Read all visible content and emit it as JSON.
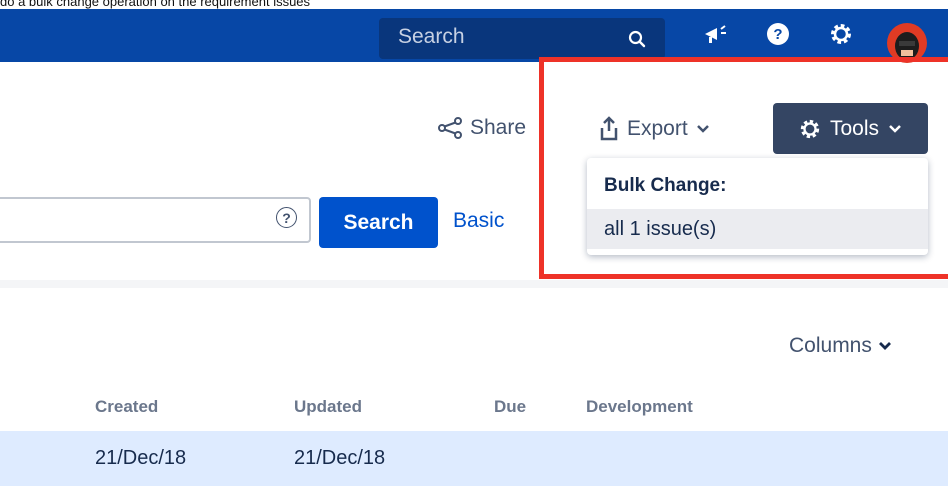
{
  "caption": "do a bulk change operation on the requirement issues",
  "topbar": {
    "search_placeholder": "Search",
    "icons": [
      "search-icon",
      "megaphone-icon",
      "help-icon",
      "gear-icon",
      "avatar"
    ]
  },
  "toolbar": {
    "share_label": "Share",
    "export_label": "Export",
    "tools_label": "Tools"
  },
  "tools_menu": {
    "header": "Bulk Change:",
    "items": [
      {
        "label": "all 1 issue(s)"
      }
    ]
  },
  "search_bar": {
    "help_symbol": "?",
    "search_label": "Search",
    "basic_label": "Basic"
  },
  "results": {
    "columns_label": "Columns",
    "headers": [
      "Created",
      "Updated",
      "Due",
      "Development"
    ],
    "rows": [
      {
        "created": "21/Dec/18",
        "updated": "21/Dec/18",
        "due": "",
        "development": ""
      }
    ]
  },
  "colors": {
    "nav_bg": "#0747a6",
    "primary": "#0052cc",
    "tools_bg": "#344563",
    "highlight": "#ee3228",
    "selected_row": "#deebff"
  }
}
